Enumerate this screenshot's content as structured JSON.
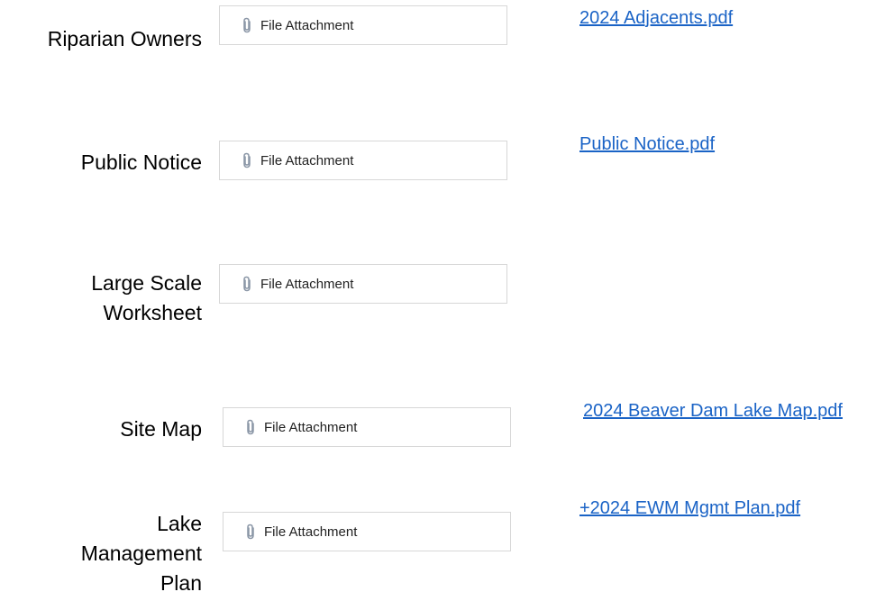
{
  "rows": [
    {
      "label": "Riparian Owners",
      "attachment_label": "File Attachment",
      "link": "2024 Adjacents.pdf"
    },
    {
      "label": "Public Notice",
      "attachment_label": "File Attachment",
      "link": "Public Notice.pdf"
    },
    {
      "label_lines": [
        "Large Scale",
        "Worksheet"
      ],
      "attachment_label": "File Attachment"
    },
    {
      "label": "Site Map",
      "attachment_label": "File Attachment",
      "link": "2024 Beaver Dam Lake Map.pdf"
    },
    {
      "label_lines": [
        "Lake",
        "Management",
        "Plan"
      ],
      "attachment_label": "File Attachment",
      "link": "+2024 EWM Mgmt Plan.pdf"
    }
  ],
  "colors": {
    "link": "#1a63c6",
    "border": "#d7d7d7",
    "clip": "#8a96a6"
  },
  "icons": {
    "attachment": "paperclip-icon"
  }
}
